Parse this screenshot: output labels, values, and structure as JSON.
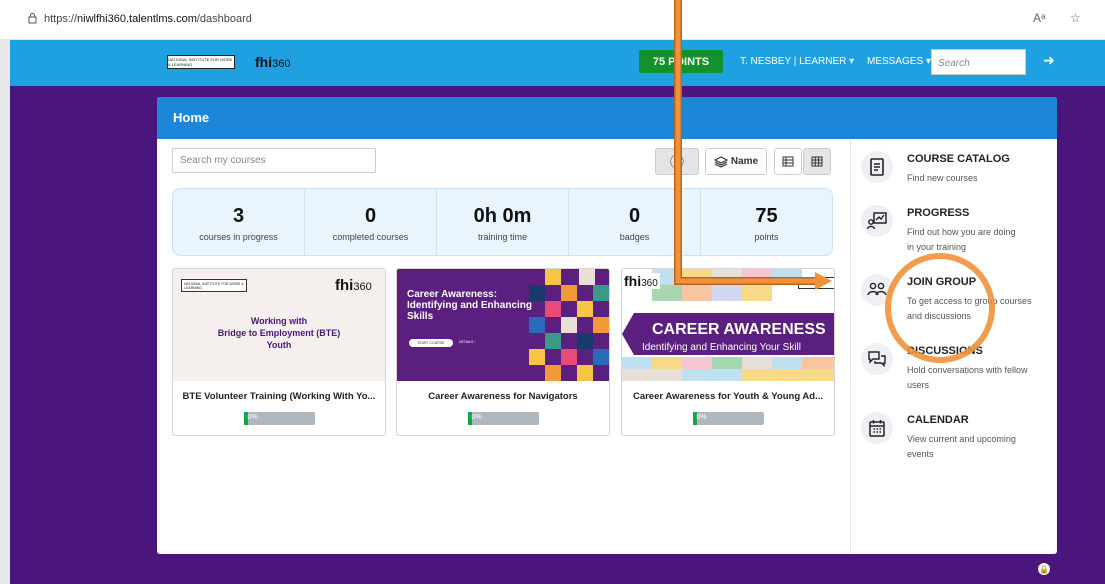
{
  "browser": {
    "url_prefix": "https://",
    "url_host": "niwlfhi360.talentlms.com",
    "url_path": "/dashboard",
    "reader_icon": "Aᵃ",
    "fav_icon": "☆"
  },
  "header": {
    "logo_nwl_text": "NATIONAL INSTITUTE FOR WORK & LEARNING",
    "logo_fhi": "fhi",
    "logo_fhi_num": "360",
    "points_label": "75 POINTS",
    "user_label": "T. NESBEY | LEARNER ▾",
    "messages_label": "MESSAGES ▾",
    "search_placeholder": "Search",
    "logout_icon": "➜"
  },
  "main": {
    "title": "Home",
    "search_placeholder": "Search my courses",
    "info_icon": "ⓘ",
    "sort_label": "Name",
    "stats": [
      {
        "value": "3",
        "label": "courses in progress"
      },
      {
        "value": "0",
        "label": "completed courses"
      },
      {
        "value": "0h 0m",
        "label": "training time"
      },
      {
        "value": "0",
        "label": "badges"
      },
      {
        "value": "75",
        "label": "points"
      }
    ],
    "courses": [
      {
        "title": "BTE Volunteer Training (Working With Yo...",
        "progress_label": "0%",
        "progress": 0,
        "thumb_org": "NATIONAL INSTITUTE FOR WORK & LEARNING",
        "thumb_fhi": "fhi",
        "thumb_fhi_num": "360",
        "thumb_line1": "Working with",
        "thumb_line2": "Bridge to Employment (BTE)",
        "thumb_line3": "Youth"
      },
      {
        "title": "Career Awareness for Navigators",
        "progress_label": "0%",
        "progress": 0,
        "thumb_line1": "Career Awareness:",
        "thumb_line2": "Identifying and Enhancing",
        "thumb_line3": "Skills",
        "thumb_btn": "START COURSE",
        "thumb_more": "DETAILS ›"
      },
      {
        "title": "Career Awareness for Youth & Young Ad...",
        "progress_label": "0%",
        "progress": 0,
        "thumb_fhi": "fhi",
        "thumb_fhi_num": "360",
        "thumb_org": "WORK & LE",
        "thumb_line1": "CAREER AWARENESS",
        "thumb_line2": "Identifying and Enhancing Your Skill"
      }
    ]
  },
  "sidebar": [
    {
      "title": "COURSE CATALOG",
      "desc1": "Find new courses",
      "desc2": "",
      "icon": "catalog-icon"
    },
    {
      "title": "PROGRESS",
      "desc1": "Find out how you are doing",
      "desc2": "in your training",
      "icon": "progress-icon"
    },
    {
      "title": "JOIN GROUP",
      "desc1": "To get access to group courses",
      "desc2": "and discussions",
      "icon": "group-icon"
    },
    {
      "title": "DISCUSSIONS",
      "desc1": "Hold conversations with fellow",
      "desc2": "users",
      "icon": "discussions-icon"
    },
    {
      "title": "CALENDAR",
      "desc1": "View current and upcoming",
      "desc2": "events",
      "icon": "calendar-icon"
    }
  ],
  "colors": {
    "header_blue": "#1fa0e0",
    "panel_head_blue": "#1c87d8",
    "purple_bg": "#4b167c",
    "points_green": "#11922a",
    "annotation_orange": "#f0923a"
  }
}
